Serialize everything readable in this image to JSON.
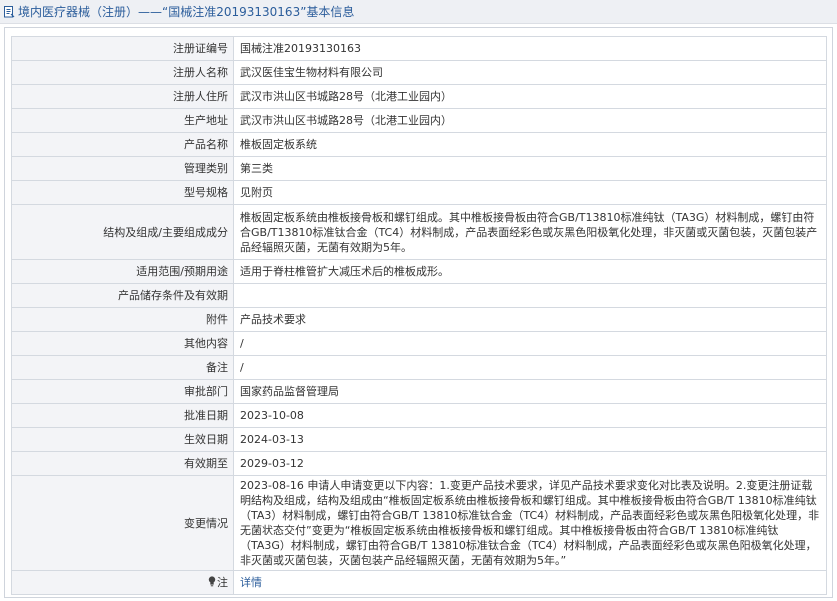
{
  "header": {
    "title": "境内医疗器械（注册）——“国械注准20193130163”基本信息"
  },
  "rows": [
    {
      "label": "注册证编号",
      "value": "国械注准20193130163"
    },
    {
      "label": "注册人名称",
      "value": "武汉医佳宝生物材料有限公司"
    },
    {
      "label": "注册人住所",
      "value": "武汉市洪山区书城路28号（北港工业园内）"
    },
    {
      "label": "生产地址",
      "value": "武汉市洪山区书城路28号（北港工业园内）"
    },
    {
      "label": "产品名称",
      "value": "椎板固定板系统"
    },
    {
      "label": "管理类别",
      "value": "第三类"
    },
    {
      "label": "型号规格",
      "value": "见附页"
    },
    {
      "label": "结构及组成/主要组成成分",
      "value": "椎板固定板系统由椎板接骨板和螺钉组成。其中椎板接骨板由符合GB/T13810标准纯钛（TA3G）材料制成，螺钉由符合GB/T13810标准钛合金（TC4）材料制成，产品表面经彩色或灰黑色阳极氧化处理，非灭菌或灭菌包装，灭菌包装产品经辐照灭菌，无菌有效期为5年。"
    },
    {
      "label": "适用范围/预期用途",
      "value": "适用于脊柱椎管扩大减压术后的椎板成形。"
    },
    {
      "label": "产品储存条件及有效期",
      "value": ""
    },
    {
      "label": "附件",
      "value": "产品技术要求"
    },
    {
      "label": "其他内容",
      "value": "/"
    },
    {
      "label": "备注",
      "value": "/"
    },
    {
      "label": "审批部门",
      "value": "国家药品监督管理局"
    },
    {
      "label": "批准日期",
      "value": "2023-10-08"
    },
    {
      "label": "生效日期",
      "value": "2024-03-13"
    },
    {
      "label": "有效期至",
      "value": "2029-03-12"
    },
    {
      "label": "变更情况",
      "value": "2023-08-16 申请人申请变更以下内容：1.变更产品技术要求，详见产品技术要求变化对比表及说明。2.变更注册证载明结构及组成，结构及组成由“椎板固定板系统由椎板接骨板和螺钉组成。其中椎板接骨板由符合GB/T 13810标准纯钛（TA3）材料制成，螺钉由符合GB/T 13810标准钛合金（TC4）材料制成，产品表面经彩色或灰黑色阳极氧化处理，非无菌状态交付”变更为“椎板固定板系统由椎板接骨板和螺钉组成。其中椎板接骨板由符合GB/T 13810标准纯钛（TA3G）材料制成，螺钉由符合GB/T 13810标准钛合金（TC4）材料制成，产品表面经彩色或灰黑色阳极氧化处理，非灭菌或灭菌包装，灭菌包装产品经辐照灭菌，无菌有效期为5年。”"
    }
  ],
  "footer_row": {
    "label": "注",
    "link": "详情",
    "icon": "lightbulb-icon"
  },
  "colors": {
    "label_bg": "#f3f4f7",
    "border": "#d4d9e0",
    "link": "#2b5d9b",
    "header_bg": "#eef0f4"
  }
}
